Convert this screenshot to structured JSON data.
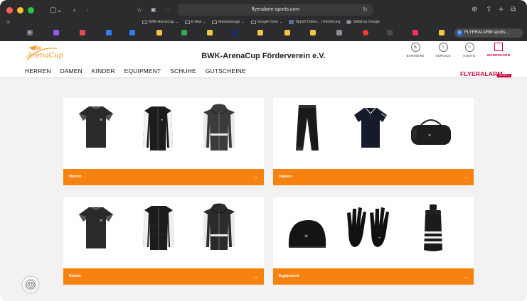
{
  "browser": {
    "url": "flyeralarm-sports.com",
    "bookmarks": [
      {
        "label": "BWK-ArenaCup",
        "type": "folder",
        "chevron": true
      },
      {
        "label": "E-Mail",
        "type": "folder",
        "chevron": true
      },
      {
        "label": "Mediastorage",
        "type": "folder",
        "chevron": true
      },
      {
        "label": "Google Drive",
        "type": "folder",
        "chevron": true
      },
      {
        "label": "Tipp10 Online... | Einführung",
        "type": "page"
      },
      {
        "label": "Skillshop Google",
        "type": "page"
      }
    ],
    "active_tab": {
      "favicon": "F",
      "label": "FLYERALARM sports..."
    }
  },
  "site": {
    "logo": {
      "top": "BWK",
      "script": "ArenaCup"
    },
    "title": "BWK-ArenaCup Förderverein e.V.",
    "nav": [
      "HERREN",
      "DAMEN",
      "KINDER",
      "EQUIPMENT",
      "SCHUHE",
      "GUTSCHEINE"
    ],
    "utility": [
      {
        "label": "BARRIERE",
        "icon": "accessibility-icon"
      },
      {
        "label": "SERVICE",
        "icon": "info-icon"
      },
      {
        "label": "KONTO",
        "icon": "user-icon"
      },
      {
        "label": "WARENKORB",
        "icon": "cart-icon"
      }
    ],
    "brand": {
      "name": "FLYERALARM",
      "sub": "SPORTS"
    }
  },
  "categories": [
    {
      "label": "Herren",
      "products": [
        "t-shirt",
        "track-jacket",
        "hoodie-jacket"
      ]
    },
    {
      "label": "Damen",
      "products": [
        "track-pants",
        "polo-shirt",
        "sports-bag"
      ]
    },
    {
      "label": "Kinder",
      "products": [
        "t-shirt",
        "padded-jacket",
        "hoodie-jacket"
      ]
    },
    {
      "label": "Equipment",
      "products": [
        "beanie",
        "gloves",
        "water-bottle"
      ]
    }
  ],
  "colors": {
    "accent": "#f7820f",
    "brand": "#d4003a",
    "logo": "#f7941d",
    "chrome": "#2c2c2e"
  },
  "arrow": "→"
}
